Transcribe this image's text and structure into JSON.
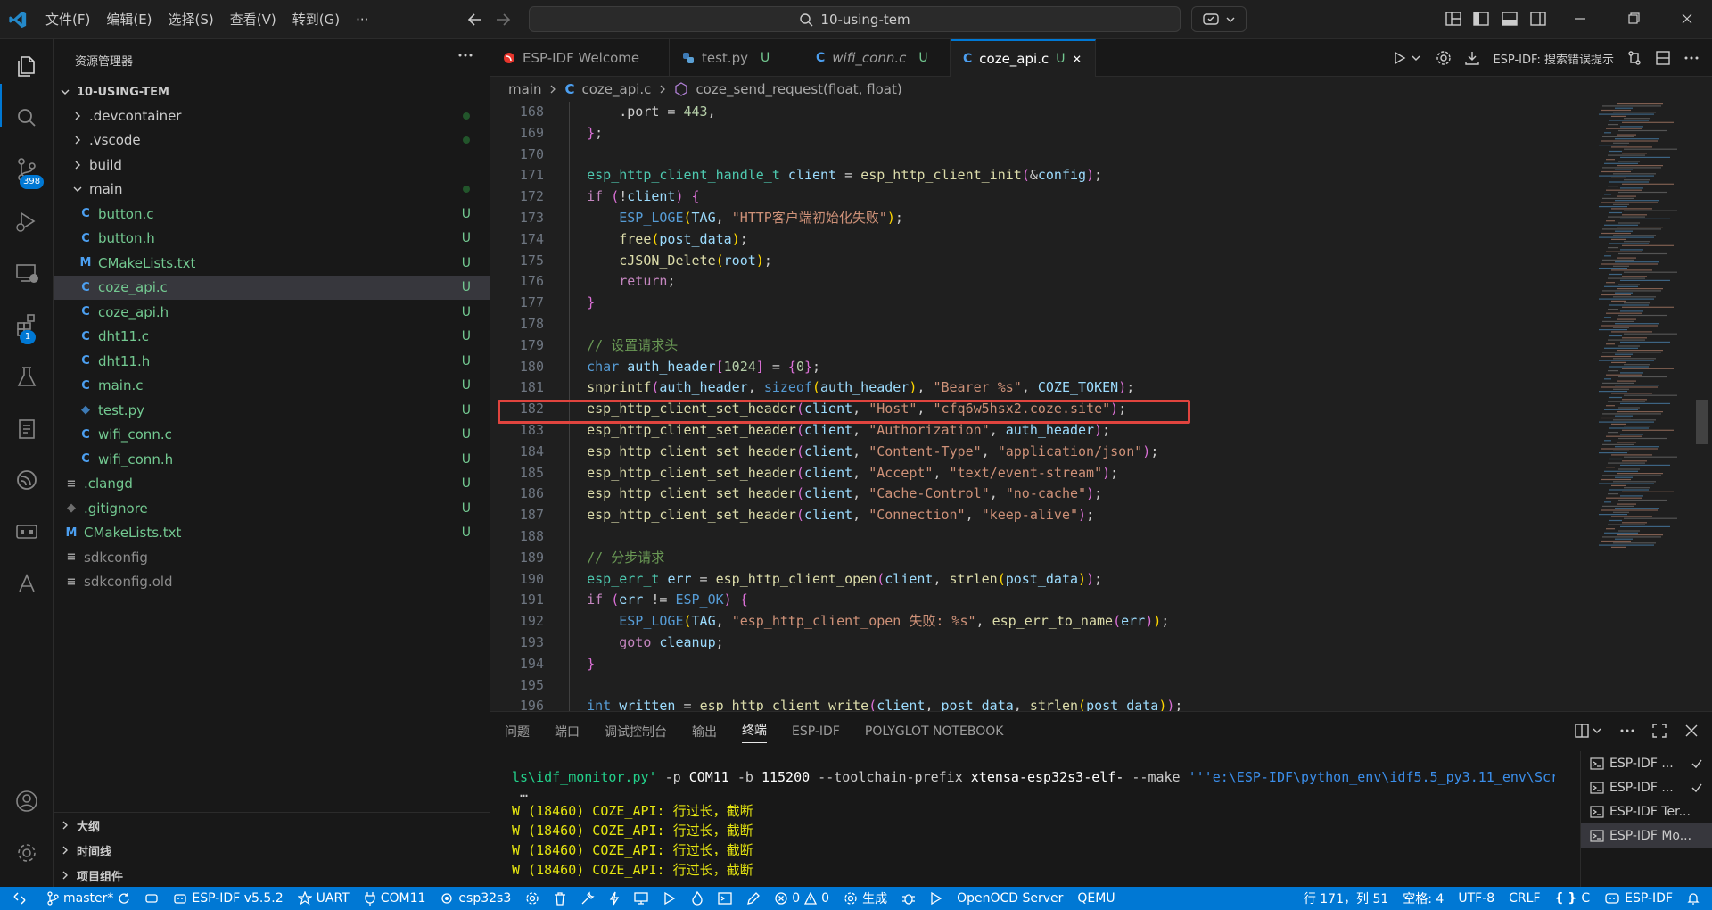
{
  "menu": [
    "文件(F)",
    "编辑(E)",
    "选择(S)",
    "查看(V)",
    "转到(G)",
    "···"
  ],
  "command_center": {
    "text": "10-using-tem"
  },
  "activity": {
    "source_control_badge": "398",
    "extensions_badge": "1"
  },
  "sidebar": {
    "title": "资源管理器",
    "root": "10-USING-TEM",
    "items": [
      {
        "label": ".devcontainer",
        "type": "folder",
        "level": 1,
        "status": "dot"
      },
      {
        "label": ".vscode",
        "type": "folder",
        "level": 1,
        "status": "dot"
      },
      {
        "label": "build",
        "type": "folder",
        "level": 1,
        "status": ""
      },
      {
        "label": "main",
        "type": "folder-open",
        "level": 1,
        "status": "dot"
      },
      {
        "label": "button.c",
        "type": "c",
        "level": 2,
        "status": "U"
      },
      {
        "label": "button.h",
        "type": "c",
        "level": 2,
        "status": "U"
      },
      {
        "label": "CMakeLists.txt",
        "type": "m",
        "level": 2,
        "status": "U"
      },
      {
        "label": "coze_api.c",
        "type": "c",
        "level": 2,
        "status": "U",
        "selected": true
      },
      {
        "label": "coze_api.h",
        "type": "c",
        "level": 2,
        "status": "U"
      },
      {
        "label": "dht11.c",
        "type": "c",
        "level": 2,
        "status": "U"
      },
      {
        "label": "dht11.h",
        "type": "c",
        "level": 2,
        "status": "U"
      },
      {
        "label": "main.c",
        "type": "c",
        "level": 2,
        "status": "U"
      },
      {
        "label": "test.py",
        "type": "py",
        "level": 2,
        "status": "U"
      },
      {
        "label": "wifi_conn.c",
        "type": "c",
        "level": 2,
        "status": "U"
      },
      {
        "label": "wifi_conn.h",
        "type": "c",
        "level": 2,
        "status": "U"
      },
      {
        "label": ".clangd",
        "type": "txt",
        "level": 1,
        "status": "U"
      },
      {
        "label": ".gitignore",
        "type": "git",
        "level": 1,
        "status": "U"
      },
      {
        "label": "CMakeLists.txt",
        "type": "m",
        "level": 1,
        "status": "U"
      },
      {
        "label": "sdkconfig",
        "type": "txt",
        "level": 1,
        "status": "",
        "dim": true
      },
      {
        "label": "sdkconfig.old",
        "type": "txt",
        "level": 1,
        "status": "",
        "dim": true
      }
    ],
    "bottom_sections": [
      "大纲",
      "时间线",
      "项目组件"
    ]
  },
  "tabs": [
    {
      "label": "ESP-IDF Welcome",
      "icon": "espressif",
      "status": ""
    },
    {
      "label": "test.py",
      "icon": "py",
      "status": "U"
    },
    {
      "label": "wifi_conn.c",
      "icon": "c",
      "status": "U",
      "italic": true
    },
    {
      "label": "coze_api.c",
      "icon": "c",
      "status": "U",
      "active": true
    }
  ],
  "editor_actions": {
    "label": "ESP-IDF: 搜索错误提示"
  },
  "breadcrumb": {
    "folder": "main",
    "file": "coze_api.c",
    "symbol": "coze_send_request(float, float)"
  },
  "code": {
    "line_numbers": [
      "168",
      "169",
      "170",
      "171",
      "172",
      "173",
      "174",
      "175",
      "176",
      "177",
      "178",
      "179",
      "180",
      "181",
      "182",
      "183",
      "184",
      "185",
      "186",
      "187",
      "188",
      "189",
      "190",
      "191",
      "192",
      "193",
      "194",
      "195",
      "196"
    ],
    "highlighted_line": "182"
  },
  "panel": {
    "tabs": [
      "问题",
      "端口",
      "调试控制台",
      "输出",
      "终端",
      "ESP-IDF",
      "POLYGLOT NOTEBOOK"
    ],
    "active_tab": "终端",
    "terminal_lines": [
      "W (18460) COZE_API: 行过长，截断",
      "W (18460) COZE_API: 行过长，截断",
      "W (18460) COZE_API: 行过长，截断",
      "W (18460) COZE_API: 行过长，截断"
    ],
    "terminal_list": [
      {
        "label": "ESP-IDF ...",
        "check": true
      },
      {
        "label": "ESP-IDF ...",
        "check": true
      },
      {
        "label": "ESP-IDF Ter...",
        "check": false
      },
      {
        "label": "ESP-IDF Mo...",
        "check": false,
        "selected": true
      }
    ]
  },
  "statusbar": {
    "branch": "master*",
    "idf_version": "ESP-IDF v5.5.2",
    "uart": "UART",
    "port": "COM11",
    "target": "esp32s3",
    "problems_errors": "0",
    "problems_warnings": "0",
    "build": "生成",
    "openocd": "OpenOCD Server",
    "qemu": "QEMU",
    "cursor": "行 171，列 51",
    "spaces": "空格: 4",
    "encoding": "UTF-8",
    "eol": "CRLF",
    "language": "C",
    "esp_idf": "ESP-IDF"
  },
  "colors": {
    "accent": "#0078d4",
    "highlight_box": "#e0443e",
    "untracked": "#73c991"
  }
}
